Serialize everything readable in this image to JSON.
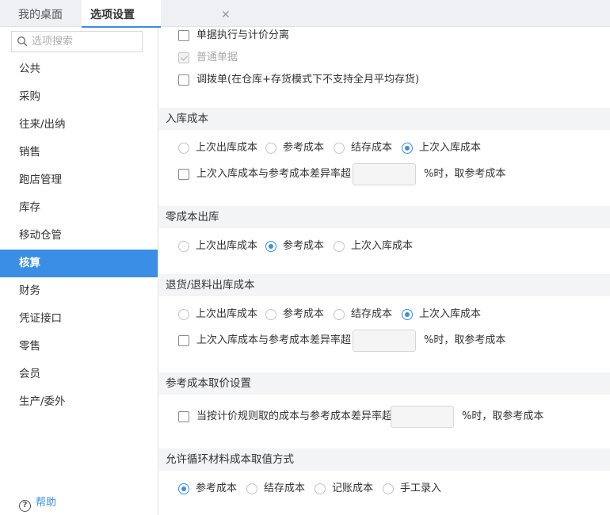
{
  "tabs": {
    "desktop": "我的桌面",
    "options": "选项设置",
    "close": "✕"
  },
  "sidebar": {
    "search_placeholder": "选项搜索",
    "items": [
      "公共",
      "采购",
      "往来/出纳",
      "销售",
      "跑店管理",
      "库存",
      "移动仓管",
      "核算",
      "财务",
      "凭证接口",
      "零售",
      "会员",
      "生产/委外"
    ],
    "active": "核算",
    "help": "帮助"
  },
  "top_options": {
    "separate": "单据执行与计价分离",
    "normal": "普通单据",
    "transfer": "调拨单(在仓库+存货模式下不支持全月平均存货)"
  },
  "inbound": {
    "title": "入库成本",
    "opts": [
      "上次出库成本",
      "参考成本",
      "结存成本",
      "上次入库成本"
    ],
    "selected": "上次入库成本",
    "rule_label": "上次入库成本与参考成本差异率超",
    "rule_suffix": "%时，取参考成本",
    "rule_value": ""
  },
  "zero_cost": {
    "title": "零成本出库",
    "opts": [
      "上次出库成本",
      "参考成本",
      "上次入库成本"
    ],
    "selected": "参考成本"
  },
  "returns": {
    "title": "退货/退料出库成本",
    "opts": [
      "上次出库成本",
      "参考成本",
      "结存成本",
      "上次入库成本"
    ],
    "selected": "上次入库成本",
    "rule_label": "上次入库成本与参考成本差异率超",
    "rule_suffix": "%时，取参考成本",
    "rule_value": ""
  },
  "ref_price": {
    "title": "参考成本取价设置",
    "rule_label": "当按计价规则取的成本与参考成本差异率超",
    "rule_suffix": "%时，取参考成本",
    "rule_value": ""
  },
  "recycle": {
    "title": "允许循环材料成本取值方式",
    "opts": [
      "参考成本",
      "结存成本",
      "记账成本",
      "手工录入"
    ],
    "selected": "参考成本"
  },
  "colors": {
    "accent": "#3a8ee6",
    "section_bg": "#f3f4f6",
    "tabbar_bg": "#eef0f4"
  }
}
